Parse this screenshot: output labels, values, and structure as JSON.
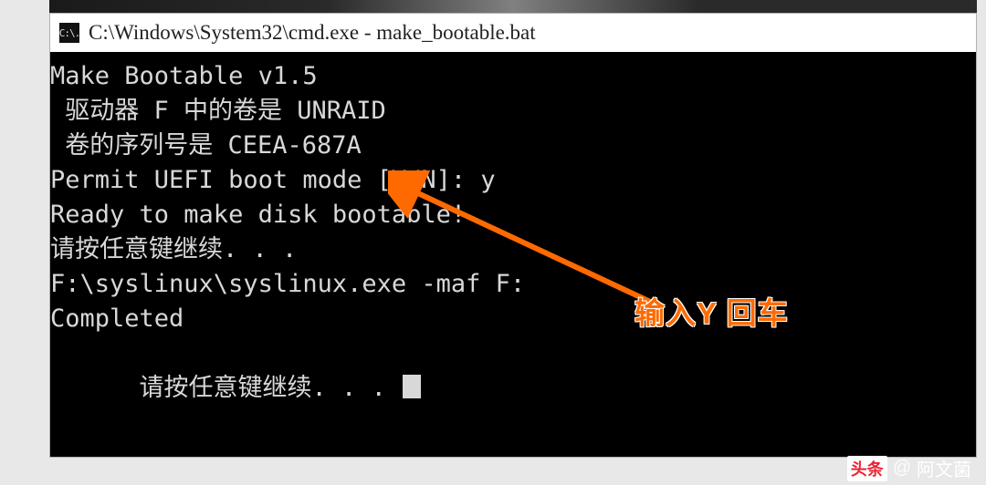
{
  "window": {
    "title": "C:\\Windows\\System32\\cmd.exe - make_bootable.bat",
    "icon_label": "C:\\."
  },
  "terminal": {
    "lines": [
      "Make Bootable v1.5",
      " 驱动器 F 中的卷是 UNRAID",
      " 卷的序列号是 CEEA-687A",
      "",
      "Permit UEFI boot mode [Y/N]: y",
      "Ready to make disk bootable!",
      "请按任意键继续. . .",
      "F:\\syslinux\\syslinux.exe -maf F:",
      "Completed",
      "",
      "请按任意键继续. . . "
    ]
  },
  "annotation": {
    "text": "输入Y 回车"
  },
  "watermark": {
    "brand": "头条",
    "at": "@",
    "name": "阿文菌"
  },
  "colors": {
    "accent": "#ff6a00"
  }
}
